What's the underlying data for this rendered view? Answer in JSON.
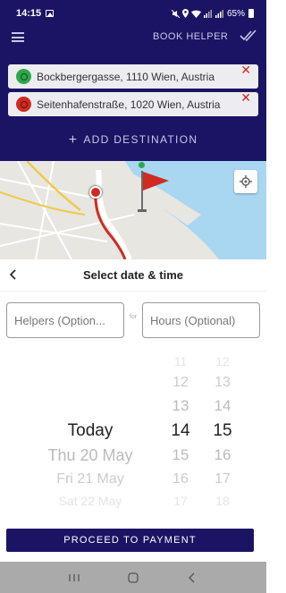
{
  "status_bar": {
    "time": "14:15",
    "battery": "65%"
  },
  "header": {
    "book_helper": "BOOK HELPER",
    "icons": {
      "menu": "hamburger-menu-icon",
      "confirm": "double-check-icon"
    }
  },
  "addresses": [
    {
      "text": "Bockbergergasse, 1110 Wien, Austria",
      "pin_color": "#2da84a"
    },
    {
      "text": "Seitenhafenstraße, 1020 Wien, Austria",
      "pin_color": "#d02a22"
    }
  ],
  "add_destination": "ADD DESTINATION",
  "sheet": {
    "title": "Select date & time",
    "helpers_placeholder": "Helpers (Option...",
    "for_label": "for",
    "hours_placeholder": "Hours (Optional)",
    "days": [
      "Today",
      "Thu 20 May",
      "Fri 21 May",
      "Sat 22 May"
    ],
    "hours": [
      "11",
      "12",
      "13",
      "14",
      "15",
      "16",
      "17"
    ],
    "minutes": [
      "12",
      "13",
      "14",
      "15",
      "16",
      "17",
      "18"
    ],
    "proceed": "PROCEED TO PAYMENT"
  },
  "colors": {
    "brand": "#1b1464",
    "accent_red": "#d02a22",
    "accent_green": "#2da84a"
  }
}
